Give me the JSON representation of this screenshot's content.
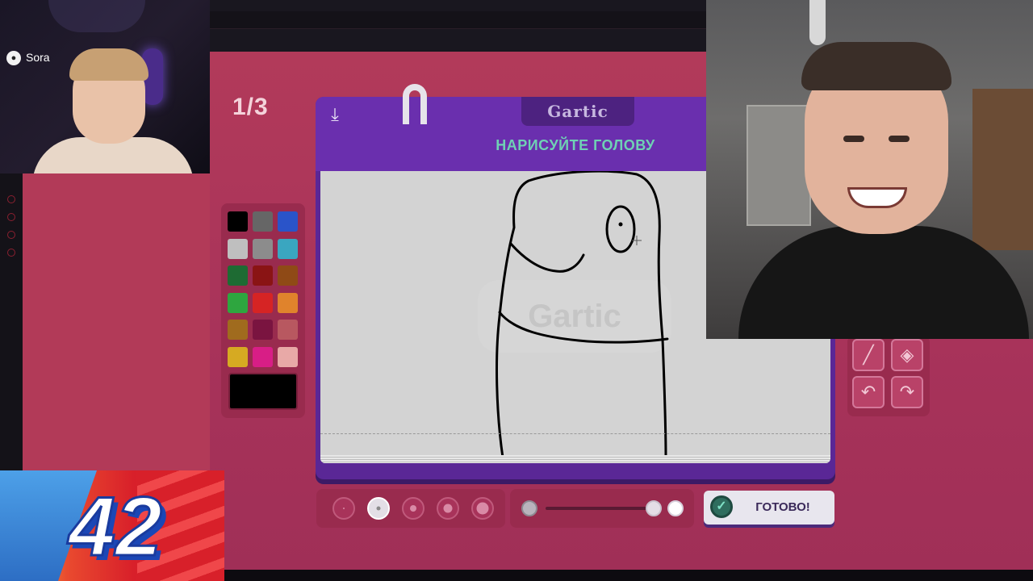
{
  "game": {
    "round_counter": "1/3",
    "logo": "Gartic",
    "prompt": "НАРИСУЙТЕ ГОЛОВУ",
    "watermark": "Gartic",
    "done_label": "ГОТОВО!",
    "current_color": "#000000",
    "selected_brush_size_index": 1,
    "opacity_level": 1.0
  },
  "palette": [
    [
      "#000000",
      "#666666",
      "#2a54c9"
    ],
    [
      "#bfbfbf",
      "#8c8c8c",
      "#3aa6c0"
    ],
    [
      "#1e6b33",
      "#8a1414",
      "#8f4a16"
    ],
    [
      "#2ea63f",
      "#d62424",
      "#e0832c"
    ],
    [
      "#a06b1e",
      "#7a1440",
      "#b85860"
    ],
    [
      "#d6aa22",
      "#d81e86",
      "#e8a9a7"
    ]
  ],
  "tools": [
    {
      "name": "pencil-tool-icon",
      "glyph": "╱"
    },
    {
      "name": "fill-tool-icon",
      "glyph": "◈"
    },
    {
      "name": "undo-icon",
      "glyph": "↶"
    },
    {
      "name": "redo-icon",
      "glyph": "↷"
    }
  ],
  "streamer": {
    "name": "Sora"
  },
  "overlay": {
    "badge_number": "42"
  },
  "icons": {
    "download": "download-icon",
    "check": "check-icon"
  }
}
